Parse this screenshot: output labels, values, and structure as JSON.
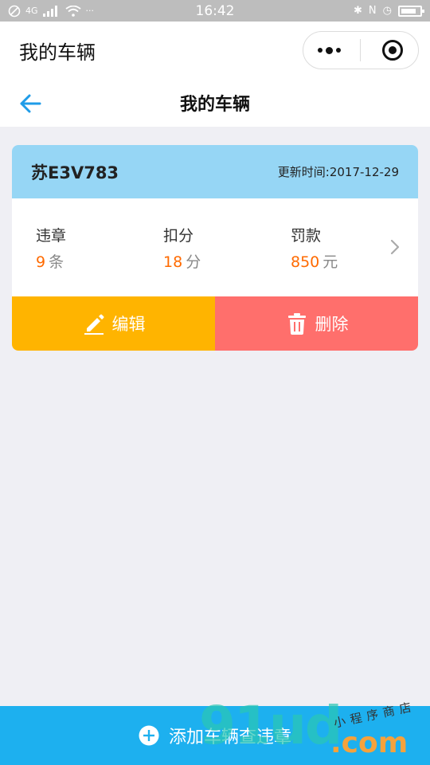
{
  "status_bar": {
    "time": "16:42",
    "signal_text": "4G",
    "more": "···"
  },
  "mp_header": {
    "title": "我的车辆"
  },
  "page_nav": {
    "title": "我的车辆"
  },
  "vehicle": {
    "plate": "苏E3V783",
    "update_time": "更新时间:2017-12-29",
    "stats": [
      {
        "label": "违章",
        "value": "9",
        "unit": "条"
      },
      {
        "label": "扣分",
        "value": "18",
        "unit": "分"
      },
      {
        "label": "罚款",
        "value": "850",
        "unit": "元"
      }
    ],
    "edit_label": "编辑",
    "delete_label": "删除"
  },
  "bottom": {
    "add_label": "添加车辆查违章"
  },
  "watermark": {
    "main": "91ud",
    "sub": "小程序商店",
    "com": ".com"
  },
  "colors": {
    "card_head": "#96d6f5",
    "edit": "#ffb400",
    "delete": "#ff6f6c",
    "accent": "#1db0ef",
    "highlight": "#ff6a00"
  },
  "icons": {
    "back": "arrow-left-icon",
    "edit": "pencil-icon",
    "delete": "trash-icon",
    "add": "plus-circle-icon",
    "more": "more-dots-icon",
    "close": "target-icon",
    "chevron": "chevron-right-icon"
  }
}
